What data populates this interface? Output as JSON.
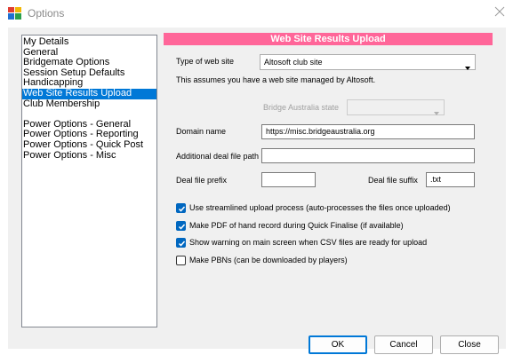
{
  "window": {
    "title": "Options",
    "icons": {
      "app": "bridge-app-icon",
      "close": "close-icon"
    }
  },
  "nav": {
    "items": [
      {
        "label": "My Details",
        "selected": false
      },
      {
        "label": "General",
        "selected": false
      },
      {
        "label": "Bridgemate Options",
        "selected": false
      },
      {
        "label": "Session Setup Defaults",
        "selected": false
      },
      {
        "label": "Handicapping",
        "selected": false
      },
      {
        "label": "Web Site Results Upload",
        "selected": true
      },
      {
        "label": "Club Membership",
        "selected": false
      },
      {
        "label": "Power Options - General",
        "selected": false
      },
      {
        "label": "Power Options - Reporting",
        "selected": false
      },
      {
        "label": "Power Options - Quick Post",
        "selected": false
      },
      {
        "label": "Power Options - Misc",
        "selected": false
      }
    ]
  },
  "panel": {
    "header": "Web Site Results Upload",
    "header_color": "#ff6699",
    "type_of_site_label": "Type of web site",
    "type_of_site_value": "Altosoft club site",
    "note": "This assumes you have a web site managed by Altosoft.",
    "ba_state_label": "Bridge Australia state",
    "ba_state_value": "",
    "domain_label": "Domain name",
    "domain_value": "https://misc.bridgeaustralia.org",
    "deal_path_label": "Additional deal file path",
    "deal_path_value": "",
    "prefix_label": "Deal file prefix",
    "prefix_value": "",
    "suffix_label": "Deal file suffix",
    "suffix_value": ".txt"
  },
  "options": {
    "streamlined": {
      "label": "Use streamlined upload process (auto-processes the files once uploaded)",
      "checked": true
    },
    "pdf": {
      "label": "Make PDF of hand record during Quick Finalise (if available)",
      "checked": true
    },
    "warning": {
      "label": "Show warning on main screen when CSV files are ready for upload",
      "checked": true
    },
    "pbn": {
      "label": "Make PBNs (can be downloaded by players)",
      "checked": false
    }
  },
  "buttons": {
    "ok": "OK",
    "cancel": "Cancel",
    "close": "Close"
  },
  "colors": {
    "selection": "#0078d7",
    "check_accent": "#0067c0"
  }
}
